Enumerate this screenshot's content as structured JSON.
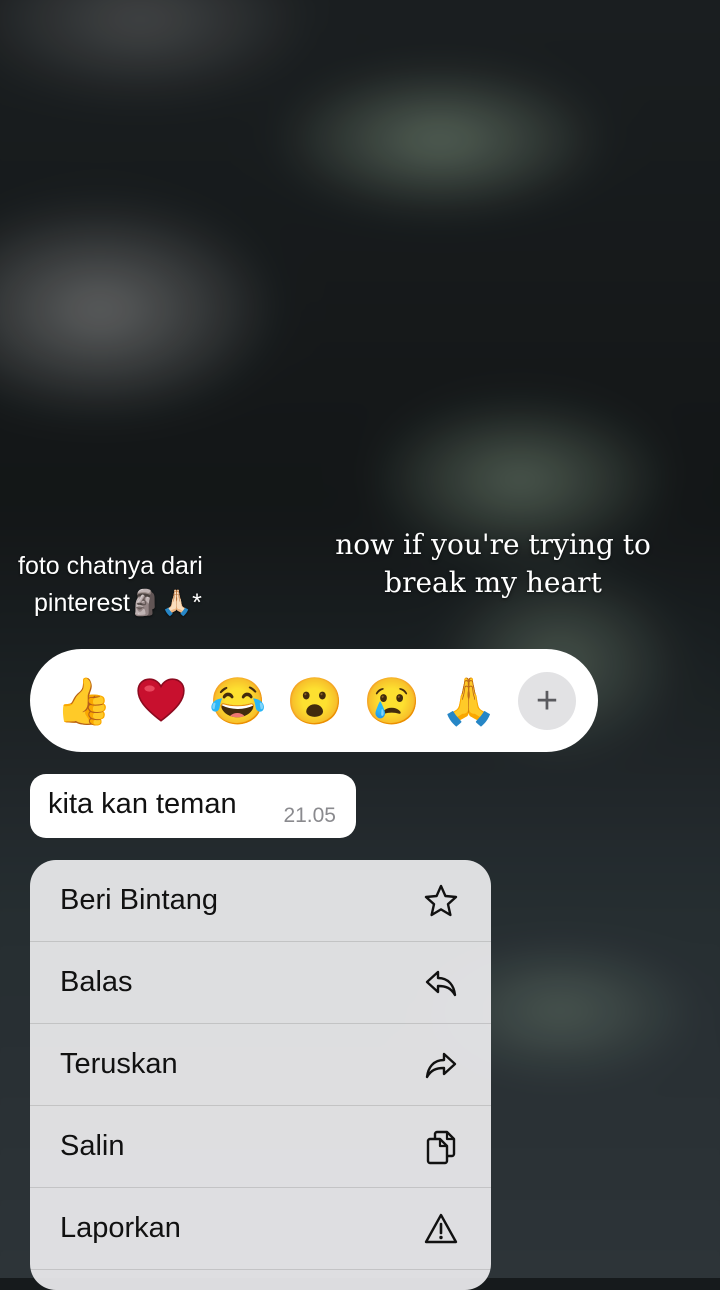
{
  "overlay": {
    "caption_line1": "foto chatnya dari",
    "caption_line2": "pinterest🗿🙏🏻*",
    "lyric_line1": "now if you're trying to",
    "lyric_line2": "break my heart"
  },
  "reactions": {
    "thumbs_up": "👍",
    "heart": "❤️",
    "laugh": "😂",
    "surprised": "😮",
    "sad": "😢",
    "pray": "🙏",
    "more": "+"
  },
  "message": {
    "text": "kita kan teman",
    "time": "21.05"
  },
  "menu": {
    "items": [
      {
        "label": "Beri Bintang",
        "icon": "star-icon"
      },
      {
        "label": "Balas",
        "icon": "reply-icon"
      },
      {
        "label": "Teruskan",
        "icon": "forward-icon"
      },
      {
        "label": "Salin",
        "icon": "copy-icon"
      },
      {
        "label": "Laporkan",
        "icon": "warning-icon"
      }
    ]
  },
  "colors": {
    "menu_bg": "#ececee",
    "bubble_bg": "#ffffff",
    "time_text": "#8a8a8e"
  }
}
